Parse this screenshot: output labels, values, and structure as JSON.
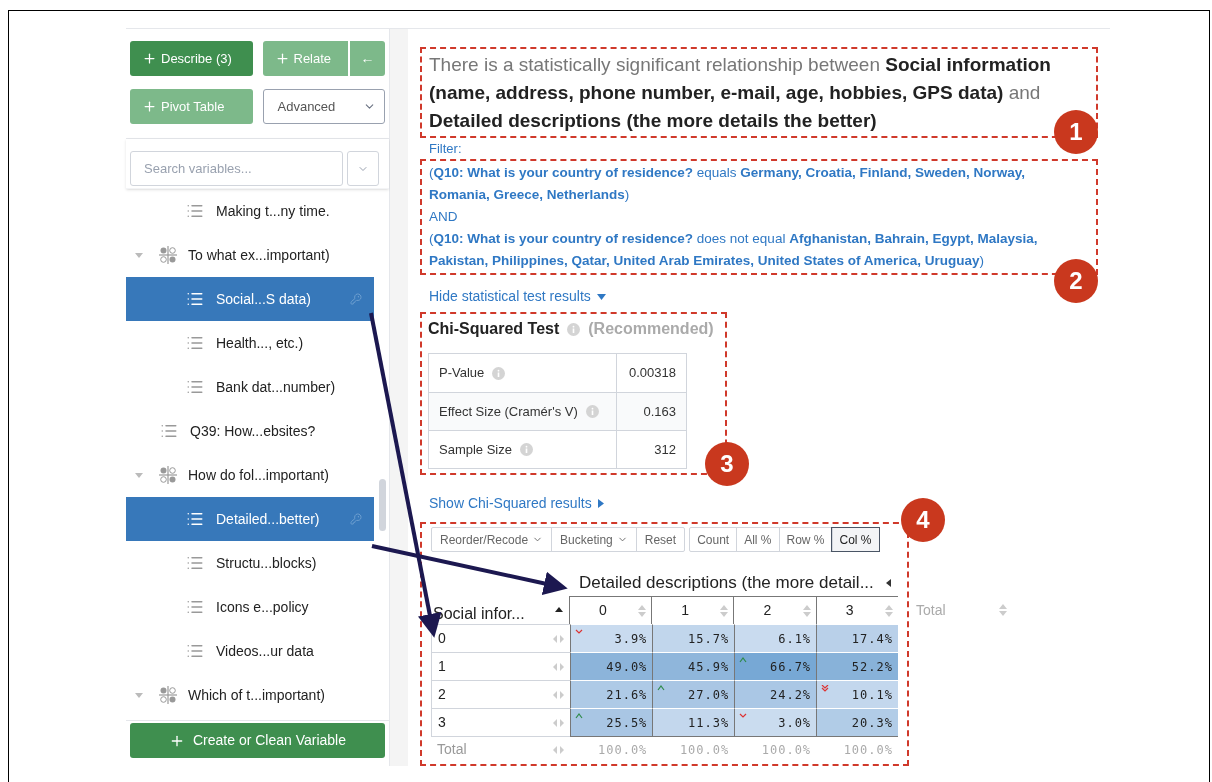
{
  "sidebar": {
    "describe_button": {
      "label": "Describe (3)",
      "disabled": false
    },
    "relate_button": {
      "label": "Relate",
      "disabled": true,
      "arrow": "←"
    },
    "pivot_button": {
      "label": "Pivot Table",
      "disabled": true
    },
    "advanced_select": {
      "value": "Advanced"
    },
    "search": {
      "placeholder": "Search variables..."
    },
    "tree": [
      {
        "children": [
          {
            "label": "Making t...ny time.",
            "selected": false
          }
        ]
      },
      {
        "label": "To what ex...important)",
        "expanded": true,
        "children": [
          {
            "label": "Social...S data)",
            "selected": true
          },
          {
            "label": "Health..., etc.)",
            "selected": false
          },
          {
            "label": "Bank dat...number)",
            "selected": false
          }
        ]
      },
      {
        "label": "Q39: How...ebsites?",
        "selected": false
      },
      {
        "label": "How do fol...important)",
        "expanded": true,
        "children": [
          {
            "label": "Detailed...better)",
            "selected": true
          },
          {
            "label": "Structu...blocks)",
            "selected": false
          },
          {
            "label": "Icons e...policy",
            "selected": false
          },
          {
            "label": "Videos...ur data",
            "selected": false
          }
        ]
      },
      {
        "kind": "group",
        "label": "Which of t...important)",
        "expanded": true
      }
    ],
    "create_button": {
      "label": "Create or Clean Variable"
    }
  },
  "summary": {
    "text": "There is a statistically significant relationship between **Social information (name, address, phone number, e-mail, age, hobbies, GPS data)** and **Detailed descriptions (the more details the better)**",
    "badge": "1"
  },
  "filter": {
    "label": "Filter:",
    "badge": "2",
    "lines": [
      "(**Q10: What is your country of residence?** equals **Germany, Croatia, Finland, Sweden, Norway, Romania, Greece, Netherlands**)",
      "AND",
      "(**Q10: What is your country of residence?** does not equal **Afghanistan, Bahrain, Egypt, Malaysia, Pakistan, Philippines, Qatar, United Arab Emirates, United States of America, Uruguay**)"
    ]
  },
  "hide_link": "Hide statistical test results",
  "chi_test": {
    "title": "Chi-Squared Test",
    "note": "(Recommended)",
    "badge": "3",
    "rows": [
      {
        "label": "P-Value",
        "value": "0.00318"
      },
      {
        "label": "Effect Size (Cramér's V)",
        "value": "0.163"
      },
      {
        "label": "Sample Size",
        "value": "312"
      }
    ]
  },
  "show_link": "Show Chi-Squared results",
  "crosstab": {
    "badge": "4",
    "toolbar": [
      {
        "label": "Reorder/Recode",
        "kind": "dropdown"
      },
      {
        "label": "Bucketing",
        "kind": "dropdown"
      },
      {
        "label": "Reset",
        "kind": "button"
      }
    ],
    "modes": [
      {
        "label": "Count",
        "selected": false
      },
      {
        "label": "All %",
        "selected": false
      },
      {
        "label": "Row %",
        "selected": false
      },
      {
        "label": "Col %",
        "selected": true
      }
    ],
    "column_title": "Detailed descriptions (the more detail...",
    "row_title": "Social infor...",
    "columns": [
      "0",
      "1",
      "2",
      "3"
    ],
    "total_column": "Total",
    "rows": [
      {
        "label": "0",
        "cells": [
          {
            "value": "3.9%",
            "kind": "lower",
            "color": "#c9dbef"
          },
          {
            "value": "15.7%",
            "kind": "plain",
            "color": "#c1d6ec"
          },
          {
            "value": "6.1%",
            "kind": "plain",
            "color": "#c9dbef"
          },
          {
            "value": "17.4%",
            "kind": "plain",
            "color": "#b9d0e9"
          }
        ]
      },
      {
        "label": "1",
        "cells": [
          {
            "value": "49.0%",
            "kind": "plain",
            "color": "#8cb4da"
          },
          {
            "value": "45.9%",
            "kind": "plain",
            "color": "#8fb6db"
          },
          {
            "value": "66.7%",
            "kind": "higher",
            "color": "#77a8d5"
          },
          {
            "value": "52.2%",
            "kind": "plain",
            "color": "#88b2d9"
          }
        ]
      },
      {
        "label": "2",
        "cells": [
          {
            "value": "21.6%",
            "kind": "plain",
            "color": "#aecae6"
          },
          {
            "value": "27.0%",
            "kind": "higher",
            "color": "#a9c6e4"
          },
          {
            "value": "24.2%",
            "kind": "plain",
            "color": "#aac7e5"
          },
          {
            "value": "10.1%",
            "kind": "lowest",
            "color": "#c3d7ed"
          }
        ]
      },
      {
        "label": "3",
        "cells": [
          {
            "value": "25.5%",
            "kind": "higher",
            "color": "#a9c6e4"
          },
          {
            "value": "11.3%",
            "kind": "plain",
            "color": "#c3d7ed"
          },
          {
            "value": "3.0%",
            "kind": "lower",
            "color": "#cadcef"
          },
          {
            "value": "20.3%",
            "kind": "plain",
            "color": "#b1cce7"
          }
        ]
      }
    ],
    "total_row": {
      "label": "Total",
      "values": [
        "100.0%",
        "100.0%",
        "100.0%",
        "100.0%"
      ]
    }
  }
}
